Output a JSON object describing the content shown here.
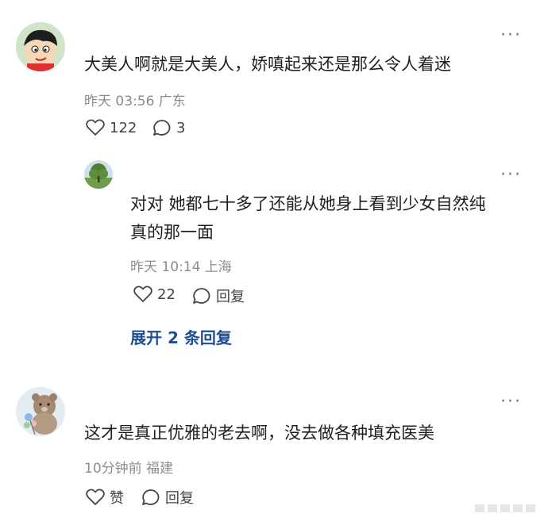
{
  "comments": [
    {
      "text": "大美人啊就是大美人，娇嗔起来还是那么令人着迷",
      "meta": "昨天 03:56 广东",
      "likes": "122",
      "replies": "3",
      "avatar": "cartoon-boy-avatar"
    },
    {
      "text_line1": "对对 她都七十多了还能从她身上看到少女自然纯",
      "text_line2": "真的那一面",
      "meta": "昨天 10:14 上海",
      "likes": "22",
      "reply_label": "回复",
      "avatar": "tree-avatar"
    },
    {
      "text": "这才是真正优雅的老去啊，没去做各种填充医美",
      "meta": "10分钟前 福建",
      "like_label": "赞",
      "reply_label": "回复",
      "avatar": "teddy-bear-avatar"
    }
  ],
  "expand_replies": "展开 2 条回复",
  "more_glyph": "···",
  "colors": {
    "link": "#1f4f91",
    "meta": "#8c8c8c"
  }
}
